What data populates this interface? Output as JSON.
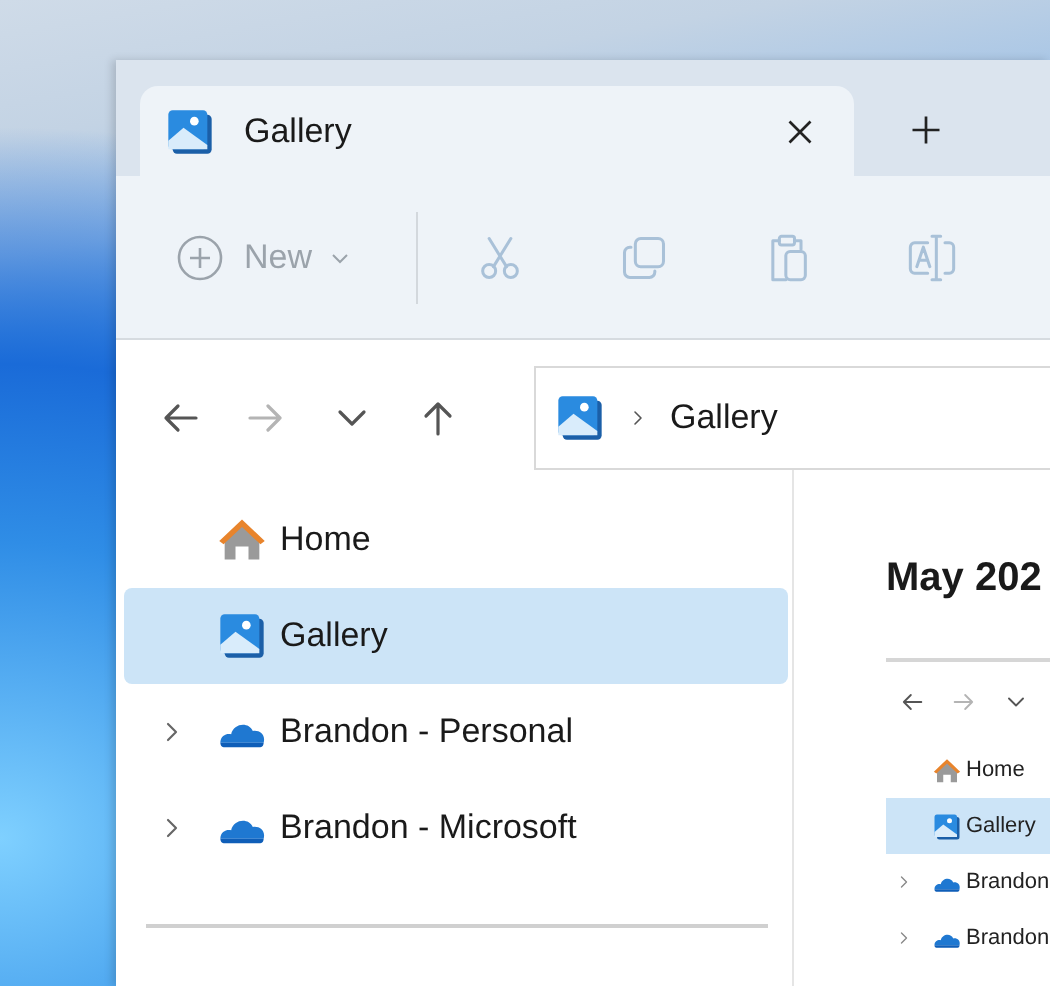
{
  "tabs": [
    {
      "label": "Gallery",
      "selected": true
    }
  ],
  "toolbar": {
    "new_button": {
      "label": "New",
      "disabled": true
    },
    "actions": [
      {
        "kind": "cut",
        "disabled": true
      },
      {
        "kind": "copy",
        "disabled": true
      },
      {
        "kind": "paste",
        "disabled": true
      },
      {
        "kind": "rename",
        "disabled": true
      }
    ]
  },
  "nav": [
    {
      "kind": "back",
      "disabled": false
    },
    {
      "kind": "forward",
      "disabled": true
    },
    {
      "kind": "recent",
      "disabled": false
    },
    {
      "kind": "up",
      "disabled": false
    }
  ],
  "address": {
    "kind": "gallery",
    "crumbs": [
      "Gallery"
    ]
  },
  "sidebar": {
    "items": [
      {
        "label": "Home",
        "kind": "home",
        "expandable": false,
        "selected": false
      },
      {
        "label": "Gallery",
        "kind": "gallery",
        "expandable": false,
        "selected": true
      },
      {
        "label": "Brandon - Personal",
        "kind": "cloud",
        "expandable": true,
        "selected": false
      },
      {
        "label": "Brandon - Microsoft",
        "kind": "cloud",
        "expandable": true,
        "selected": false
      }
    ]
  },
  "content": {
    "heading": "May 202",
    "preview": {
      "nav": [
        {
          "kind": "back",
          "disabled": false
        },
        {
          "kind": "forward",
          "disabled": true
        },
        {
          "kind": "recent",
          "disabled": false
        }
      ],
      "items": [
        {
          "label": "Home",
          "kind": "home",
          "expandable": false,
          "selected": false
        },
        {
          "label": "Gallery",
          "kind": "gallery",
          "expandable": false,
          "selected": true
        },
        {
          "label": "Brandon",
          "kind": "cloud",
          "expandable": true,
          "selected": false
        },
        {
          "label": "Brandon",
          "kind": "cloud",
          "expandable": true,
          "selected": false
        }
      ]
    }
  }
}
